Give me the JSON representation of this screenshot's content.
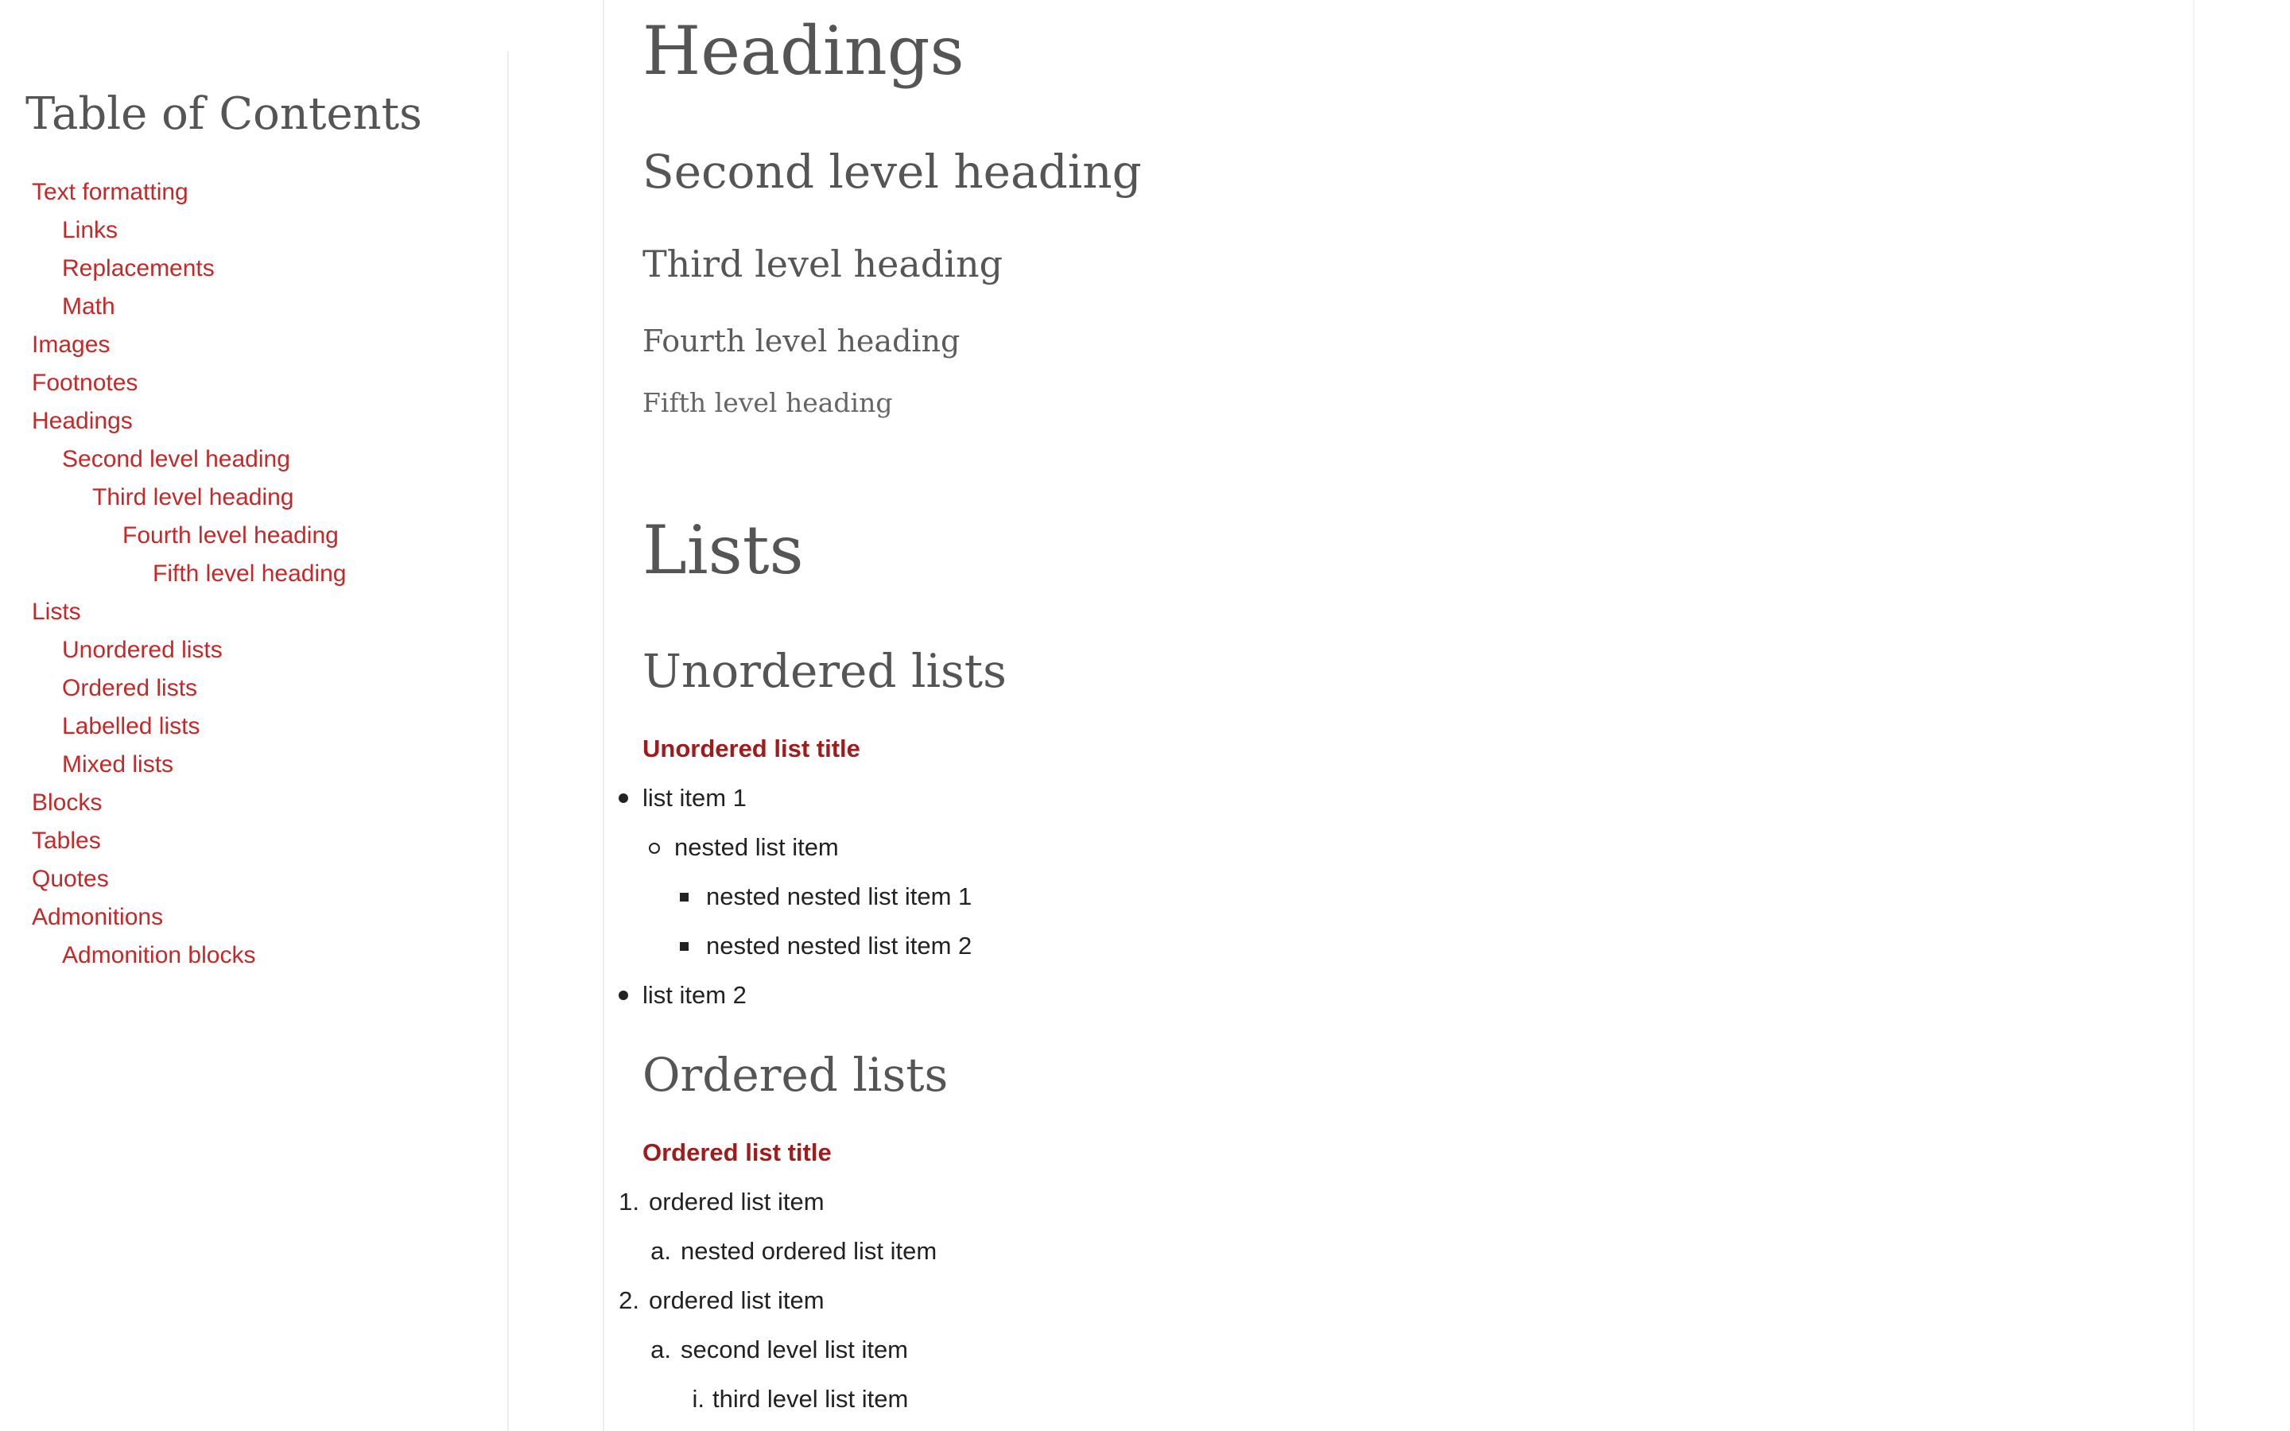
{
  "toc": {
    "title": "Table of Contents",
    "items": [
      {
        "label": "Text formatting",
        "level": 1
      },
      {
        "label": "Links",
        "level": 2
      },
      {
        "label": "Replacements",
        "level": 2
      },
      {
        "label": "Math",
        "level": 2
      },
      {
        "label": "Images",
        "level": 1
      },
      {
        "label": "Footnotes",
        "level": 1
      },
      {
        "label": "Headings",
        "level": 1
      },
      {
        "label": "Second level heading",
        "level": 2
      },
      {
        "label": "Third level heading",
        "level": 3
      },
      {
        "label": "Fourth level heading",
        "level": 4
      },
      {
        "label": "Fifth level heading",
        "level": 5
      },
      {
        "label": "Lists",
        "level": 1
      },
      {
        "label": "Unordered lists",
        "level": 2
      },
      {
        "label": "Ordered lists",
        "level": 2
      },
      {
        "label": "Labelled lists",
        "level": 2
      },
      {
        "label": "Mixed lists",
        "level": 2
      },
      {
        "label": "Blocks",
        "level": 1
      },
      {
        "label": "Tables",
        "level": 1
      },
      {
        "label": "Quotes",
        "level": 1
      },
      {
        "label": "Admonitions",
        "level": 1
      },
      {
        "label": "Admonition blocks",
        "level": 2
      }
    ]
  },
  "content": {
    "headings_section": {
      "title": "Headings",
      "second": "Second level heading",
      "third": "Third level heading",
      "fourth": "Fourth level heading",
      "fifth": "Fifth level heading"
    },
    "lists_section": {
      "title": "Lists",
      "unordered": {
        "heading": "Unordered lists",
        "list_title": "Unordered list title",
        "item1": "list item 1",
        "nested": "nested list item",
        "nested_nested_1": "nested nested list item 1",
        "nested_nested_2": "nested nested list item 2",
        "item2": "list item 2"
      },
      "ordered": {
        "heading": "Ordered lists",
        "list_title": "Ordered list title",
        "item1_marker": "1.",
        "item1": "ordered list item",
        "item1a_marker": "a.",
        "item1a": "nested ordered list item",
        "item2_marker": "2.",
        "item2": "ordered list item",
        "item2a_marker": "a.",
        "item2a": "second level list item",
        "item2ai_marker": "i.",
        "item2ai": "third level list item"
      }
    }
  },
  "colors": {
    "link": "#c62828",
    "list_title": "#a01c1c",
    "heading": "#555555",
    "body_text": "#222222"
  }
}
